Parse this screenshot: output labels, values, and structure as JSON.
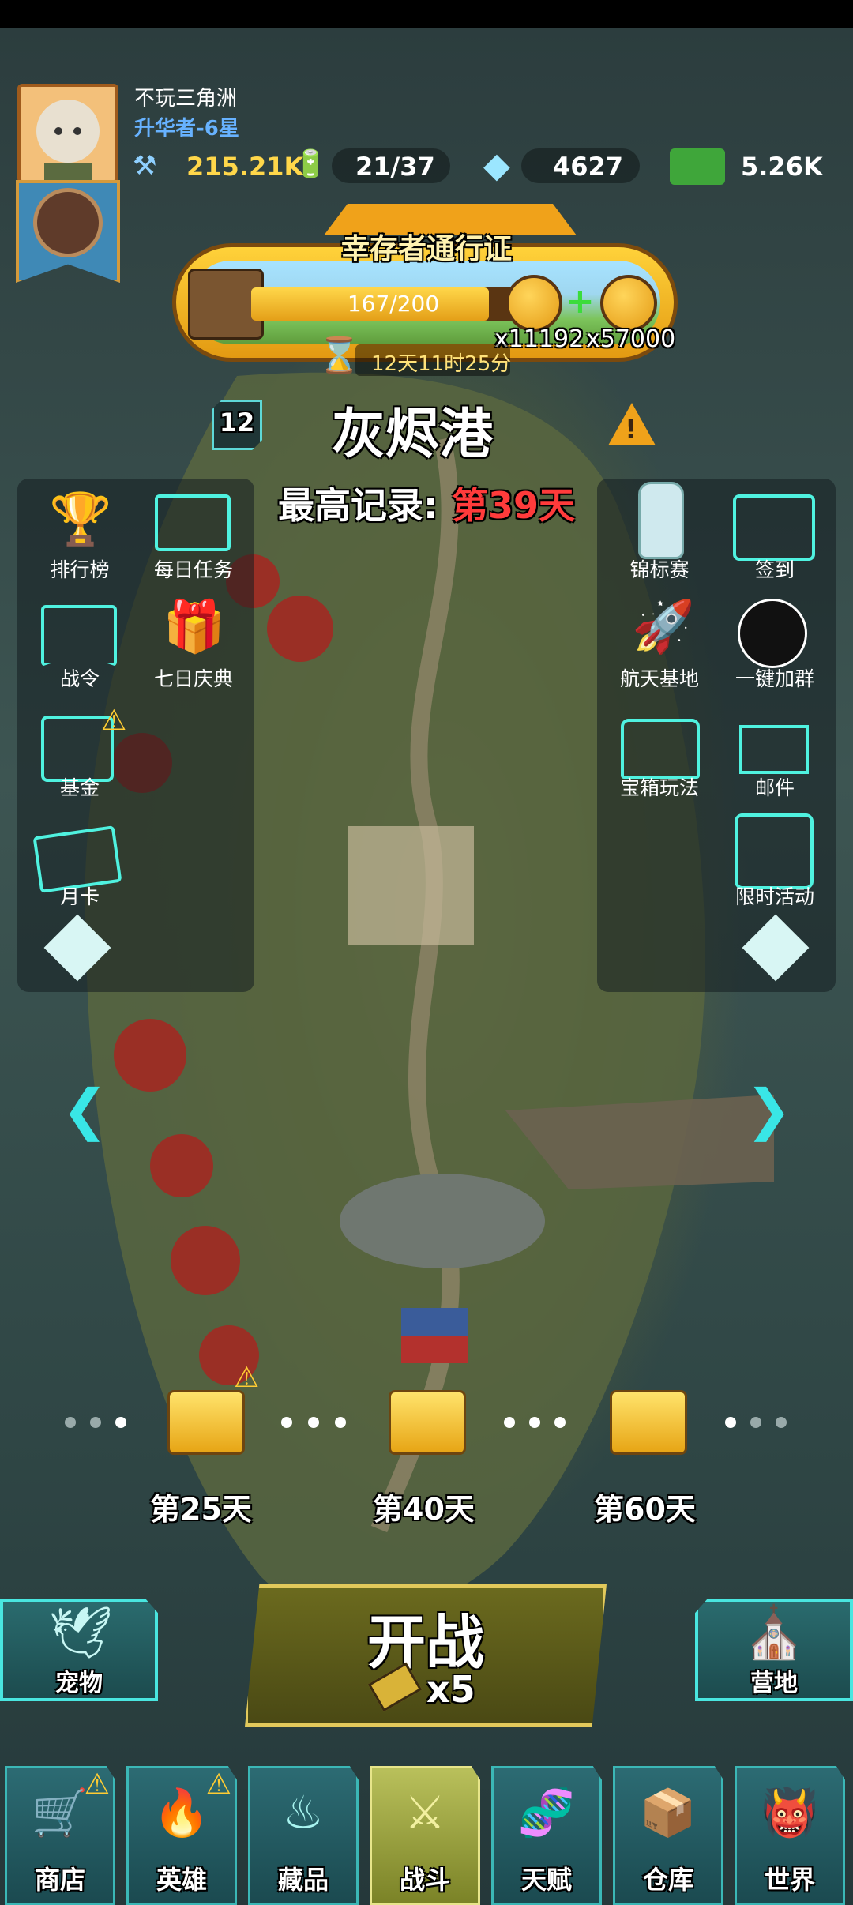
{
  "player": {
    "name": "不玩三角洲",
    "rank": "升华者-6星"
  },
  "resources": {
    "power": "215.21K",
    "energy": "21/37",
    "gems": "4627",
    "cash": "5.26K"
  },
  "pass": {
    "title": "幸存者通行证",
    "progress": "167/200",
    "progress_fraction": 0.835,
    "reward1": "x11192",
    "reward2": "x57000",
    "timer": "12天11时25分"
  },
  "location": {
    "level": "12",
    "name": "灰烬港",
    "record_label": "最高记录:",
    "record_value": "第39天"
  },
  "left_icons": [
    {
      "label": "排行榜",
      "icon": "trophy-icon"
    },
    {
      "label": "每日任务",
      "icon": "checklist-icon"
    },
    {
      "label": "战令",
      "icon": "banner-icon"
    },
    {
      "label": "七日庆典",
      "icon": "gift-icon"
    },
    {
      "label": "基金",
      "icon": "safe-icon"
    },
    {
      "label": "月卡",
      "icon": "ticket-icon"
    }
  ],
  "right_icons": [
    {
      "label": "锦标赛",
      "icon": "water-bottle-icon"
    },
    {
      "label": "签到",
      "icon": "calendar-icon"
    },
    {
      "label": "航天基地",
      "icon": "rocket-icon"
    },
    {
      "label": "一键加群",
      "icon": "penguin-icon"
    },
    {
      "label": "宝箱玩法",
      "icon": "chest-icon"
    },
    {
      "label": "邮件",
      "icon": "mail-icon"
    },
    {
      "label": "限时活动",
      "icon": "event-icon"
    }
  ],
  "milestones": [
    {
      "label": "第25天"
    },
    {
      "label": "第40天"
    },
    {
      "label": "第60天"
    }
  ],
  "battle": {
    "label": "开战",
    "cost": "x5"
  },
  "side_buttons": {
    "pet": "宠物",
    "camp": "营地"
  },
  "nav": [
    {
      "label": "商店",
      "icon": "cart-icon"
    },
    {
      "label": "英雄",
      "icon": "flame-hero-icon"
    },
    {
      "label": "藏品",
      "icon": "flame-icon"
    },
    {
      "label": "战斗",
      "icon": "rifle-icon"
    },
    {
      "label": "天赋",
      "icon": "dna-icon"
    },
    {
      "label": "仓库",
      "icon": "crate-icon"
    },
    {
      "label": "世界",
      "icon": "demon-icon"
    }
  ],
  "colors": {
    "neon": "#4ff2e0",
    "record_red": "#ff3b3b",
    "gold": "#ffd74a",
    "rank_blue": "#67b2ff"
  }
}
